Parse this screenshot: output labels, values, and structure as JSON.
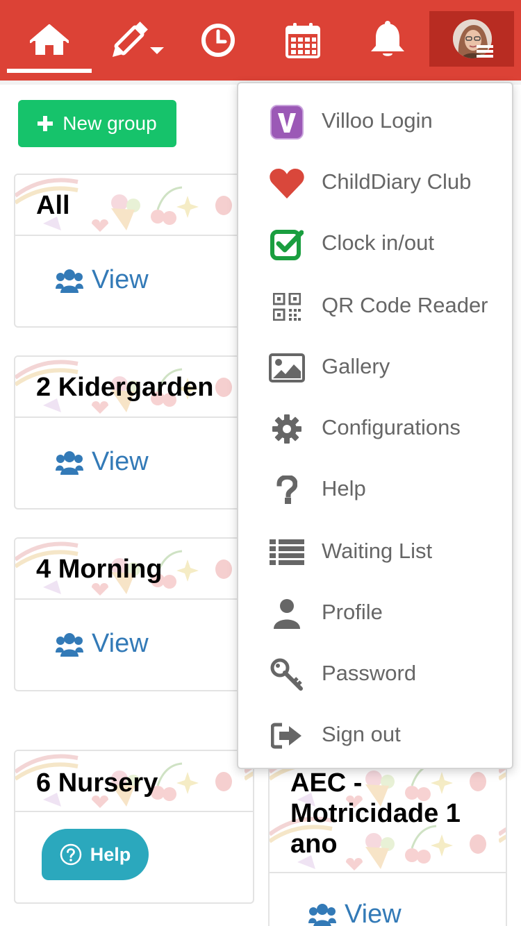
{
  "nav": {
    "items": [
      {
        "name": "home",
        "icon": "home-icon",
        "active": true
      },
      {
        "name": "edit",
        "icon": "pencil-icon"
      },
      {
        "name": "clock",
        "icon": "clock-icon"
      },
      {
        "name": "calendar",
        "icon": "calendar-icon"
      },
      {
        "name": "notifications",
        "icon": "bell-icon"
      },
      {
        "name": "user",
        "icon": "avatar"
      }
    ],
    "colors": {
      "bar": "#dc4236",
      "user_bg": "#b82c22"
    }
  },
  "toolbar": {
    "new_group_label": "New group",
    "new_group_color": "#16c36b"
  },
  "groups": [
    {
      "title": "All",
      "view_label": "View"
    },
    {
      "title": "2 Kidergarden",
      "view_label": "View"
    },
    {
      "title": "4 Morning",
      "view_label": "View"
    },
    {
      "title": "6 Nursery"
    },
    {
      "title": "AEC - Motricidade 1 ano",
      "view_label": "View"
    }
  ],
  "dropdown": {
    "items": [
      {
        "label": "Villoo Login",
        "icon": "villoo-logo-icon"
      },
      {
        "label": "ChildDiary Club",
        "icon": "heart-icon"
      },
      {
        "label": "Clock in/out",
        "icon": "checkbox-icon"
      },
      {
        "label": "QR Code Reader",
        "icon": "qrcode-icon"
      },
      {
        "label": "Gallery",
        "icon": "image-icon"
      },
      {
        "label": "Configurations",
        "icon": "gear-icon"
      },
      {
        "label": "Help",
        "icon": "question-icon"
      },
      {
        "label": "Waiting List",
        "icon": "list-icon"
      },
      {
        "label": "Profile",
        "icon": "user-icon"
      },
      {
        "label": "Password",
        "icon": "key-icon"
      },
      {
        "label": "Sign out",
        "icon": "sign-out-icon"
      }
    ]
  },
  "help_widget": {
    "label": "Help",
    "color": "#2ba8bd"
  }
}
